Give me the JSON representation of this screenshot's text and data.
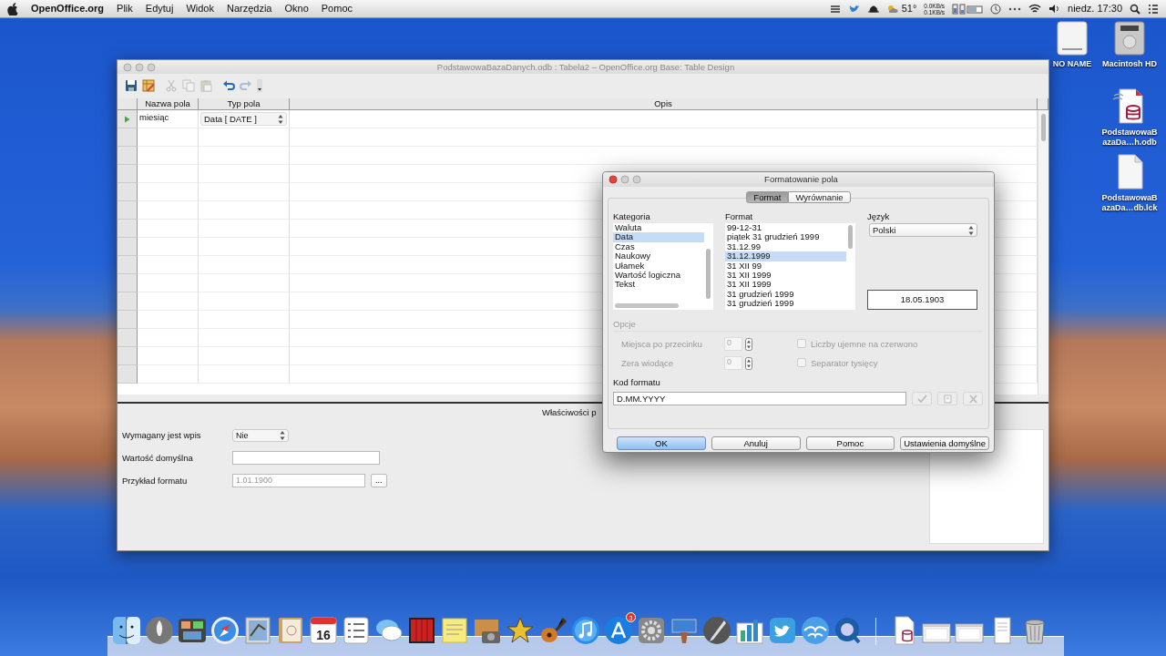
{
  "menu_bar": {
    "app_name": "OpenOffice.org",
    "menus": [
      "Plik",
      "Edytuj",
      "Widok",
      "Narzędzia",
      "Okno",
      "Pomoc"
    ],
    "temperature": "51°",
    "network_up": "0.0KB/s",
    "network_down": "0.1KB/s",
    "clock": "niedz. 17:30"
  },
  "desktop_icons": [
    {
      "kind": "drive",
      "label": "NO NAME"
    },
    {
      "kind": "disk",
      "label": "Macintosh HD"
    },
    {
      "kind": "database",
      "label": "PodstawowaBazaDa…h.odb"
    },
    {
      "kind": "document",
      "label": "PodstawowaBazaDa…db.lck"
    }
  ],
  "main_window": {
    "title": "PodstawowaBazaDanych.odb : Tabela2 – OpenOffice.org Base: Table Design",
    "toolbar": [
      {
        "kind": "save",
        "disabled": false
      },
      {
        "kind": "edit",
        "disabled": false
      },
      {
        "kind": "cut",
        "disabled": true
      },
      {
        "kind": "copy",
        "disabled": true
      },
      {
        "kind": "paste",
        "disabled": true
      },
      {
        "kind": "undo",
        "disabled": false
      },
      {
        "kind": "redo",
        "disabled": true
      },
      {
        "kind": "more",
        "disabled": false
      }
    ],
    "table": {
      "columns": [
        "Nazwa pola",
        "Typ pola",
        "Opis"
      ],
      "rows": [
        {
          "current": true,
          "name": "miesiąc",
          "type": "Data [ DATE ]"
        }
      ]
    },
    "properties": {
      "title": "Właściwości p",
      "fields": [
        {
          "kind": "select",
          "label": "Wymagany jest wpis",
          "value": "Nie",
          "disabled": false
        },
        {
          "kind": "input",
          "label": "Wartość domyślna",
          "disabled": false
        },
        {
          "kind": "input_button",
          "label": "Przykład formatu",
          "value": "1.01.1900",
          "button": "...",
          "disabled": true
        }
      ]
    }
  },
  "dialog": {
    "title": "Formatowanie pola",
    "tabs": [
      {
        "label": "Format",
        "selected": true
      },
      {
        "label": "Wyrównanie",
        "selected": false
      }
    ],
    "category": {
      "label": "Kategoria",
      "items": [
        {
          "label": "Waluta",
          "selected": false
        },
        {
          "label": "Data",
          "selected": true
        },
        {
          "label": "Czas",
          "selected": false
        },
        {
          "label": "Naukowy",
          "selected": false
        },
        {
          "label": "Ułamek",
          "selected": false
        },
        {
          "label": "Wartość logiczna",
          "selected": false
        },
        {
          "label": "Tekst",
          "selected": false
        }
      ]
    },
    "format": {
      "label": "Format",
      "items": [
        {
          "label": "99-12-31",
          "selected": false
        },
        {
          "label": "piątek 31 grudzień 1999",
          "selected": false
        },
        {
          "label": "31.12.99",
          "selected": false
        },
        {
          "label": "31.12.1999",
          "selected": true
        },
        {
          "label": "31 XII 99",
          "selected": false
        },
        {
          "label": "31 XII 1999",
          "selected": false
        },
        {
          "label": "31 XII 1999",
          "selected": false
        },
        {
          "label": "31 grudzień 1999",
          "selected": false
        },
        {
          "label": "31 grudzień 1999",
          "selected": false
        }
      ]
    },
    "language": {
      "label": "Język",
      "value": "Polski"
    },
    "preview": "18.05.1903",
    "options": {
      "label": "Opcje",
      "spinners": [
        {
          "label": "Miejsca po przecinku",
          "value": "0",
          "disabled": true
        },
        {
          "label": "Zera wiodące",
          "value": "0",
          "disabled": true
        }
      ],
      "checkboxes": [
        {
          "label": "Liczby ujemne na czerwono",
          "checked": false,
          "disabled": true
        },
        {
          "label": "Separator tysięcy",
          "checked": false,
          "disabled": true
        }
      ]
    },
    "format_code": {
      "label": "Kod formatu",
      "value": "D.MM.YYYY",
      "buttons": [
        {
          "kind": "accept",
          "disabled": true
        },
        {
          "kind": "add",
          "disabled": true
        },
        {
          "kind": "delete",
          "disabled": true
        }
      ]
    },
    "buttons": [
      {
        "label": "OK",
        "default": true
      },
      {
        "label": "Anuluj",
        "default": false
      },
      {
        "label": "Pomoc",
        "default": false
      },
      {
        "label": "Ustawienia domyślne",
        "default": false
      }
    ]
  },
  "dock": {
    "apps": [
      {
        "kind": "finder"
      },
      {
        "kind": "launchpad"
      },
      {
        "kind": "mission_control"
      },
      {
        "kind": "safari"
      },
      {
        "kind": "mail"
      },
      {
        "kind": "contacts"
      },
      {
        "kind": "calendar",
        "label": "16"
      },
      {
        "kind": "reminders"
      },
      {
        "kind": "messages"
      },
      {
        "kind": "photo_booth"
      },
      {
        "kind": "stickies"
      },
      {
        "kind": "iphoto"
      },
      {
        "kind": "imovie"
      },
      {
        "kind": "garageband"
      },
      {
        "kind": "itunes"
      },
      {
        "kind": "app_store",
        "badge": "3"
      },
      {
        "kind": "preferences"
      },
      {
        "kind": "keynote"
      },
      {
        "kind": "script"
      },
      {
        "kind": "numbers"
      },
      {
        "kind": "twitter"
      },
      {
        "kind": "openoffice"
      },
      {
        "kind": "quicktime"
      }
    ],
    "documents": [
      {
        "kind": "database_doc"
      },
      {
        "kind": "window_thumb"
      },
      {
        "kind": "window_thumb"
      },
      {
        "kind": "doc_stack"
      },
      {
        "kind": "trash"
      }
    ]
  }
}
